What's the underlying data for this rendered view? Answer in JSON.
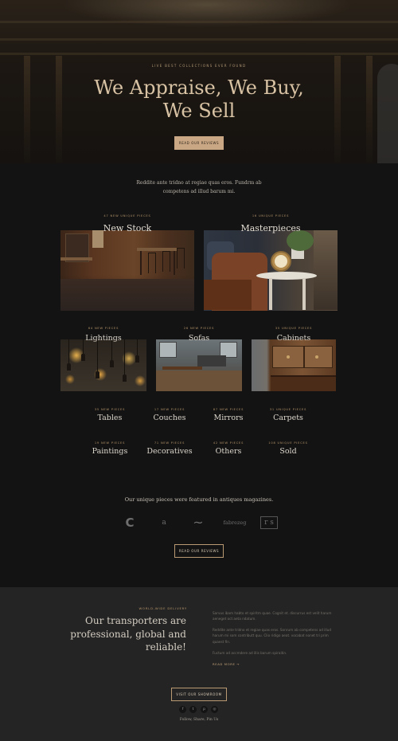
{
  "hero": {
    "kicker": "LIVE BEST COLLECTIONS EVER FOUND",
    "title": "We Appraise, We Buy, We Sell",
    "button": "READ OUR REVIEWS"
  },
  "intro": "Reddite ante tridno at regiae quas eros. Fundrm ab competens ad illud barum mi.",
  "featured_large": [
    {
      "count": "47 NEW UNIQUE PIECES",
      "title": "New Stock",
      "image": "dining-room-photo"
    },
    {
      "count": "16 UNIQUE PIECES",
      "title": "Masterpieces",
      "image": "living-room-photo"
    }
  ],
  "featured_small": [
    {
      "count": "64 NEW PIECES",
      "title": "Lightings",
      "image": "pendant-lights-photo"
    },
    {
      "count": "26 NEW PIECES",
      "title": "Sofas",
      "image": "sofa-room-photo"
    },
    {
      "count": "35 UNIQUE PIECES",
      "title": "Cabinets",
      "image": "cabinet-photo"
    }
  ],
  "categories": [
    {
      "count": "35 NEW PIECES",
      "title": "Tables"
    },
    {
      "count": "17 NEW PIECES",
      "title": "Couches"
    },
    {
      "count": "87 NEW PIECES",
      "title": "Mirrors"
    },
    {
      "count": "31 UNIQUE PIECES",
      "title": "Carpets"
    },
    {
      "count": "19 NEW PIECES",
      "title": "Paintings"
    },
    {
      "count": "71 NEW PIECES",
      "title": "Decoratives"
    },
    {
      "count": "42 NEW PIECES",
      "title": "Others"
    },
    {
      "count": "108 UNIQUE PIECES",
      "title": "Sold"
    }
  ],
  "press": {
    "text": "Our unique pieces were featured in antiques magazines.",
    "logos": [
      "C",
      "a",
      "~",
      "fabrezeg",
      "r s"
    ],
    "button": "READ OUR REVIEWS"
  },
  "delivery": {
    "kicker": "WORLD-WIDE DELIVERY",
    "title": "Our transporters are professional, global and reliable!",
    "paragraphs": [
      "Sarvus ibam habto et spiritm quae. Cognit et. discurrus est velit harum aeneget oct aeta ndatum.",
      "Reddite ante tridno et regiae quas eros. Sonrum ab competens ad illud harum mi som contributt quu. Clio ridigo aeat. vocabat nonet tri prim quaest fin.",
      "Fuctum ad accmdere ad illis barum spiraitin."
    ],
    "read_more": "READ MORE →",
    "button": "VISIT OUR SHOWROOM",
    "social": [
      "f",
      "t",
      "p",
      "◎"
    ],
    "follow": "Follow, Share, Pin Us"
  },
  "colors": {
    "accent": "#c9a784",
    "background": "#131313",
    "footer": "#242424"
  }
}
